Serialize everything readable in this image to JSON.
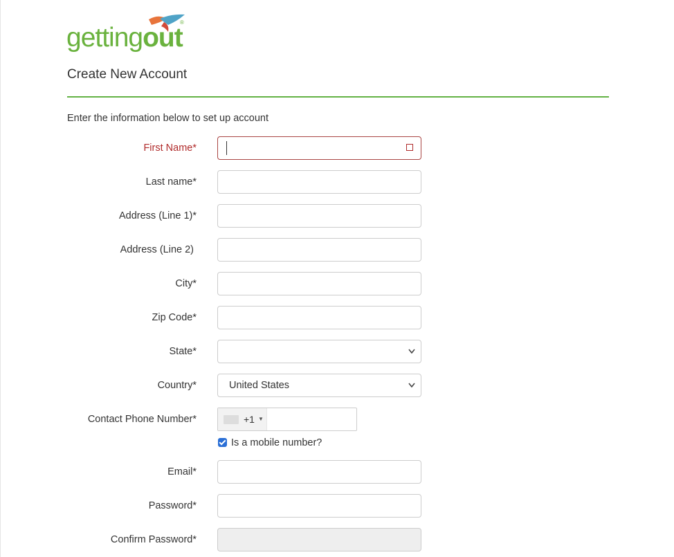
{
  "brand": {
    "logo_light": "getting",
    "logo_bold": "out",
    "registered": "®"
  },
  "header": {
    "title": "Create New Account"
  },
  "form": {
    "intro": "Enter the information below to set up account",
    "fields": {
      "first_name": {
        "label": "First Name*",
        "value": ""
      },
      "last_name": {
        "label": "Last name*",
        "value": ""
      },
      "address1": {
        "label": "Address (Line 1)*",
        "value": ""
      },
      "address2": {
        "label": "Address (Line 2)",
        "value": ""
      },
      "city": {
        "label": "City*",
        "value": ""
      },
      "zip": {
        "label": "Zip Code*",
        "value": ""
      },
      "state": {
        "label": "State*",
        "value": ""
      },
      "country": {
        "label": "Country*",
        "value": "United States"
      },
      "phone": {
        "label": "Contact Phone Number*",
        "code": "+1",
        "value": ""
      },
      "mobile": {
        "label": "Is a mobile number?",
        "checked": true
      },
      "email": {
        "label": "Email*",
        "value": ""
      },
      "password": {
        "label": "Password*",
        "value": ""
      },
      "confirm_password": {
        "label": "Confirm Password*",
        "value": ""
      }
    }
  },
  "colors": {
    "brand_green": "#6ab23e",
    "rule_green": "#62b244",
    "error_red": "#b02a2a",
    "checkbox_blue": "#2a6fd6"
  },
  "icons": {
    "error": "error-square-icon",
    "select": "chevron-down-icon",
    "phone_caret": "caret-down-icon"
  }
}
